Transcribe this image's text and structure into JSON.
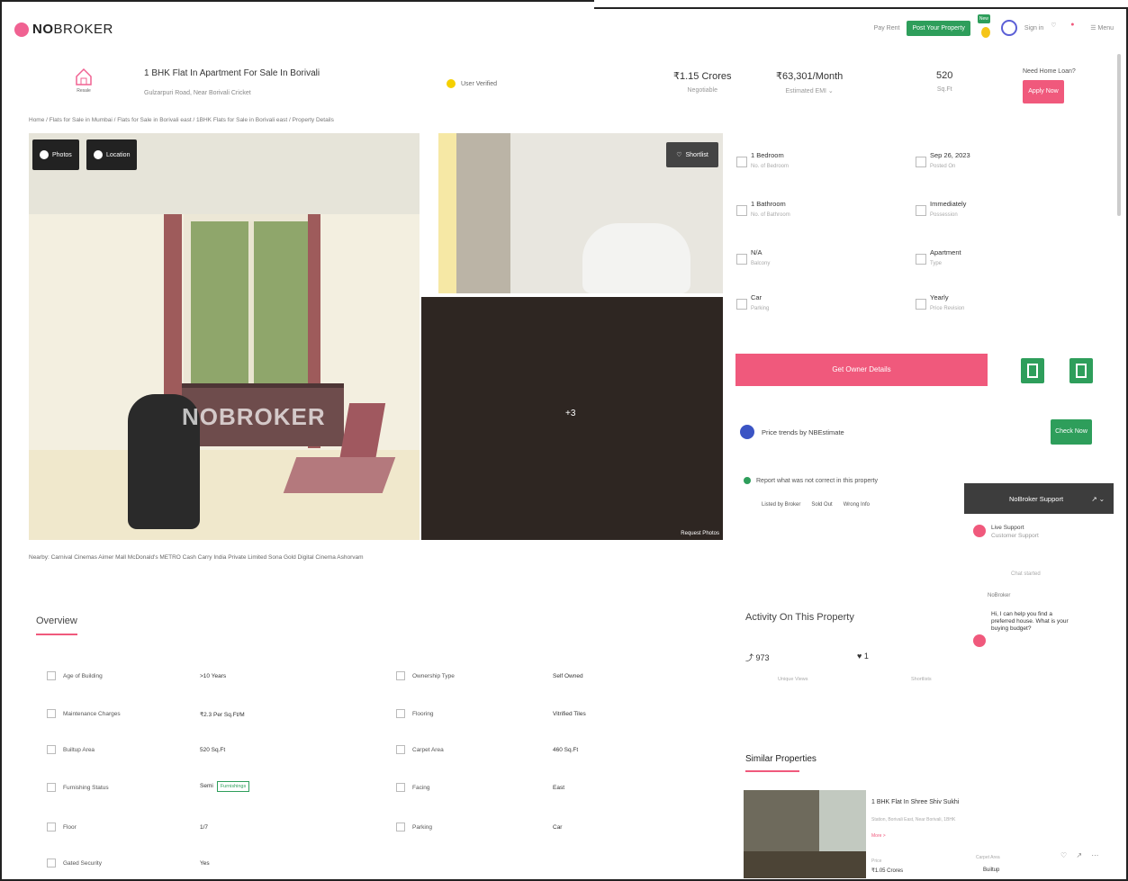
{
  "header": {
    "logo_text_bold": "NO",
    "logo_text_rest": "BROKER",
    "pay_rent": "Pay Rent",
    "post_property": "Post Your Property",
    "new_badge": "New",
    "signin": "Sign in",
    "menu": "Menu"
  },
  "property": {
    "icon_caption": "Resale",
    "title": "1 BHK Flat In Apartment For Sale In Borivali",
    "subtitle": "Gulzarpuri Road, Near Borivali Cricket",
    "verified": "User Verified",
    "price": "₹1.15 Crores",
    "price_label": "Negotiable",
    "emi": "₹63,301/Month",
    "emi_label": "Estimated EMI ⌄",
    "area": "520",
    "area_label": "Sq.Ft",
    "loan_q": "Need Home Loan?",
    "loan_btn": "Apply Now"
  },
  "breadcrumb": "Home / Flats for Sale in Mumbai / Flats for Sale in Borivali east / 1BHK Flats for Sale in Borivali east / Property Details",
  "gallery": {
    "photos_btn": "Photos",
    "location_btn": "Location",
    "shortlist": "Shortlist",
    "more_count": "+3",
    "request_photos": "Request Photos",
    "watermark": "NOBROKER"
  },
  "nearby": "Nearby:  Carnival Cinemas Aimer Mall    McDonald's    METRO Cash Carry India Private Limited    Sona Gold Digital Cinema    Ashorvam",
  "features": [
    {
      "t": "1 Bedroom",
      "s": "No. of Bedroom"
    },
    {
      "t": "Sep 26, 2023",
      "s": "Posted On"
    },
    {
      "t": "1 Bathroom",
      "s": "No. of Bathroom"
    },
    {
      "t": "Immediately",
      "s": "Possession"
    },
    {
      "t": "N/A",
      "s": "Balcony"
    },
    {
      "t": "Apartment",
      "s": "Type"
    },
    {
      "t": "Car",
      "s": "Parking"
    },
    {
      "t": "Yearly",
      "s": "Price Revision"
    }
  ],
  "actions": {
    "owner_details": "Get Owner Details",
    "price_trends": "Price trends by NBEstimate",
    "check_now": "Check Now",
    "report": "Report what was not correct in this property",
    "report_tags": [
      "Listed by Broker",
      "Sold Out",
      "Wrong Info"
    ]
  },
  "support": {
    "title": "NoBroker Support",
    "live": "Live Support",
    "live_sub": "Customer Support",
    "started": "Chat started",
    "who": "NoBroker",
    "message": "Hi, I can help you find a preferred house. What is your buying budget?"
  },
  "activity": {
    "title": "Activity On This Property",
    "views": "973",
    "views_label": "Unique Views",
    "shortlists": "1",
    "shortlists_label": "Shortlists"
  },
  "overview": {
    "title": "Overview",
    "rows": [
      {
        "label": "Age of Building",
        "value": ">10 Years",
        "label2": "Ownership Type",
        "value2": "Self Owned"
      },
      {
        "label": "Maintenance Charges",
        "value": "₹2.3 Per Sq.Ft/M",
        "label2": "Flooring",
        "value2": "Vitrified Tiles"
      },
      {
        "label": "Builtup Area",
        "value": "520 Sq.Ft",
        "label2": "Carpet Area",
        "value2": "460 Sq.Ft"
      },
      {
        "label": "Furnishing Status",
        "value": "Semi",
        "tag": "Furnishings",
        "label2": "Facing",
        "value2": "East"
      },
      {
        "label": "Floor",
        "value": "1/7",
        "label2": "Parking",
        "value2": "Car"
      },
      {
        "label": "Gated Security",
        "value": "Yes",
        "label2": "",
        "value2": ""
      }
    ]
  },
  "similar": {
    "title": "Similar Properties",
    "name": "1 BHK Flat In Shree Shiv Sukhi",
    "sub": "Station, Borivali East, Near Borivali, 1BHK",
    "more": "More >",
    "price_label": "Price",
    "price": "₹1.05 Crores",
    "r1": "Carpet Area",
    "r2": "Builtup"
  },
  "colors": {
    "brand": "#f0597c",
    "green": "#2e9e5b"
  }
}
